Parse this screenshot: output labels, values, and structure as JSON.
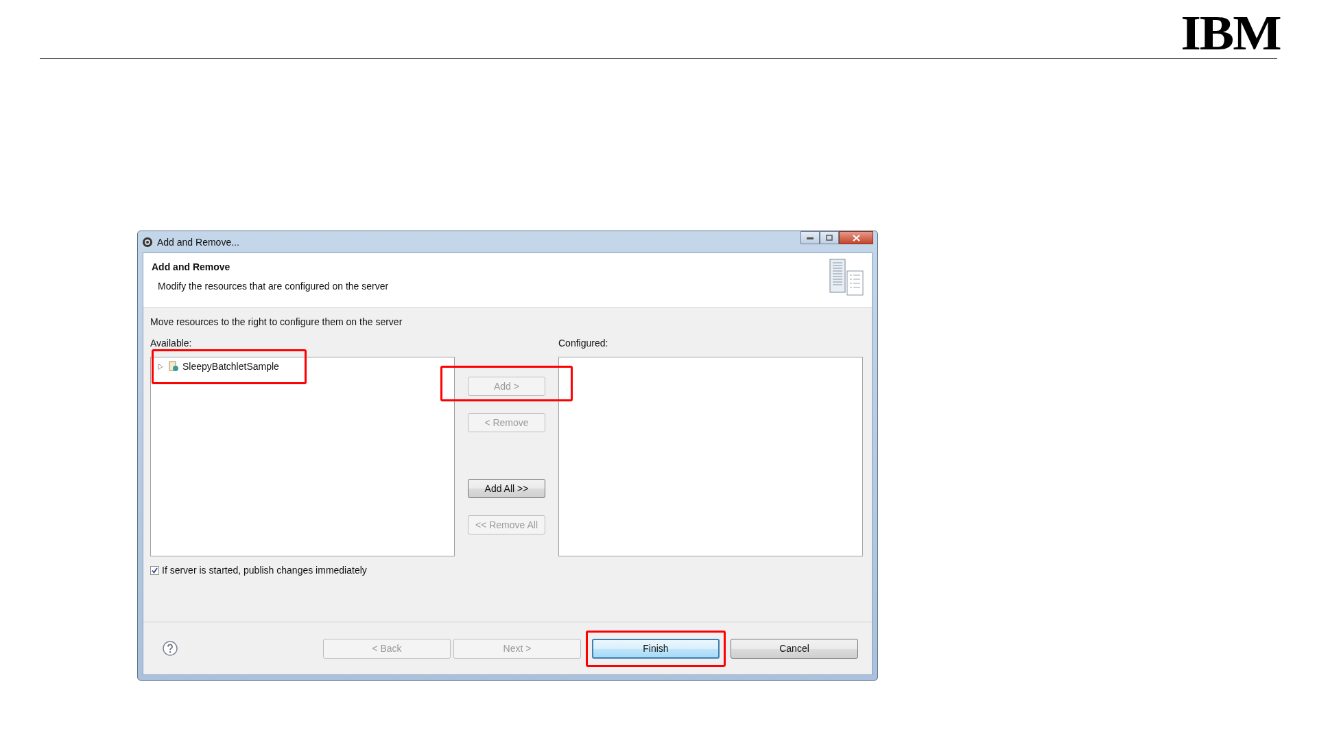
{
  "logo": {
    "text": "IBM"
  },
  "dialog": {
    "title": "Add and Remove...",
    "heading": "Add and Remove",
    "description": "Modify the resources that are configured on the server",
    "instruction": "Move resources to the right to configure them on the server",
    "available": {
      "label": "Available:",
      "items": [
        {
          "label": "SleepyBatchletSample",
          "expanded": false,
          "highlighted": true
        }
      ]
    },
    "configured": {
      "label": "Configured:"
    },
    "transfer_buttons": [
      {
        "label": "Add >",
        "disabled": true,
        "highlighted": true
      },
      {
        "label": "< Remove",
        "disabled": true,
        "highlighted": false
      },
      {
        "label": "Add All >>",
        "disabled": false,
        "highlighted": false
      },
      {
        "label": "<< Remove All",
        "disabled": true,
        "highlighted": false
      }
    ],
    "publish_option": {
      "label": "If server is started, publish changes immediately",
      "checked": true
    },
    "footer_buttons": [
      {
        "label": "< Back",
        "disabled": true,
        "default": false,
        "highlighted": false
      },
      {
        "label": "Next >",
        "disabled": true,
        "default": false,
        "highlighted": false
      },
      {
        "label": "Finish",
        "disabled": false,
        "default": true,
        "highlighted": true
      },
      {
        "label": "Cancel",
        "disabled": false,
        "default": false,
        "highlighted": false
      }
    ]
  }
}
